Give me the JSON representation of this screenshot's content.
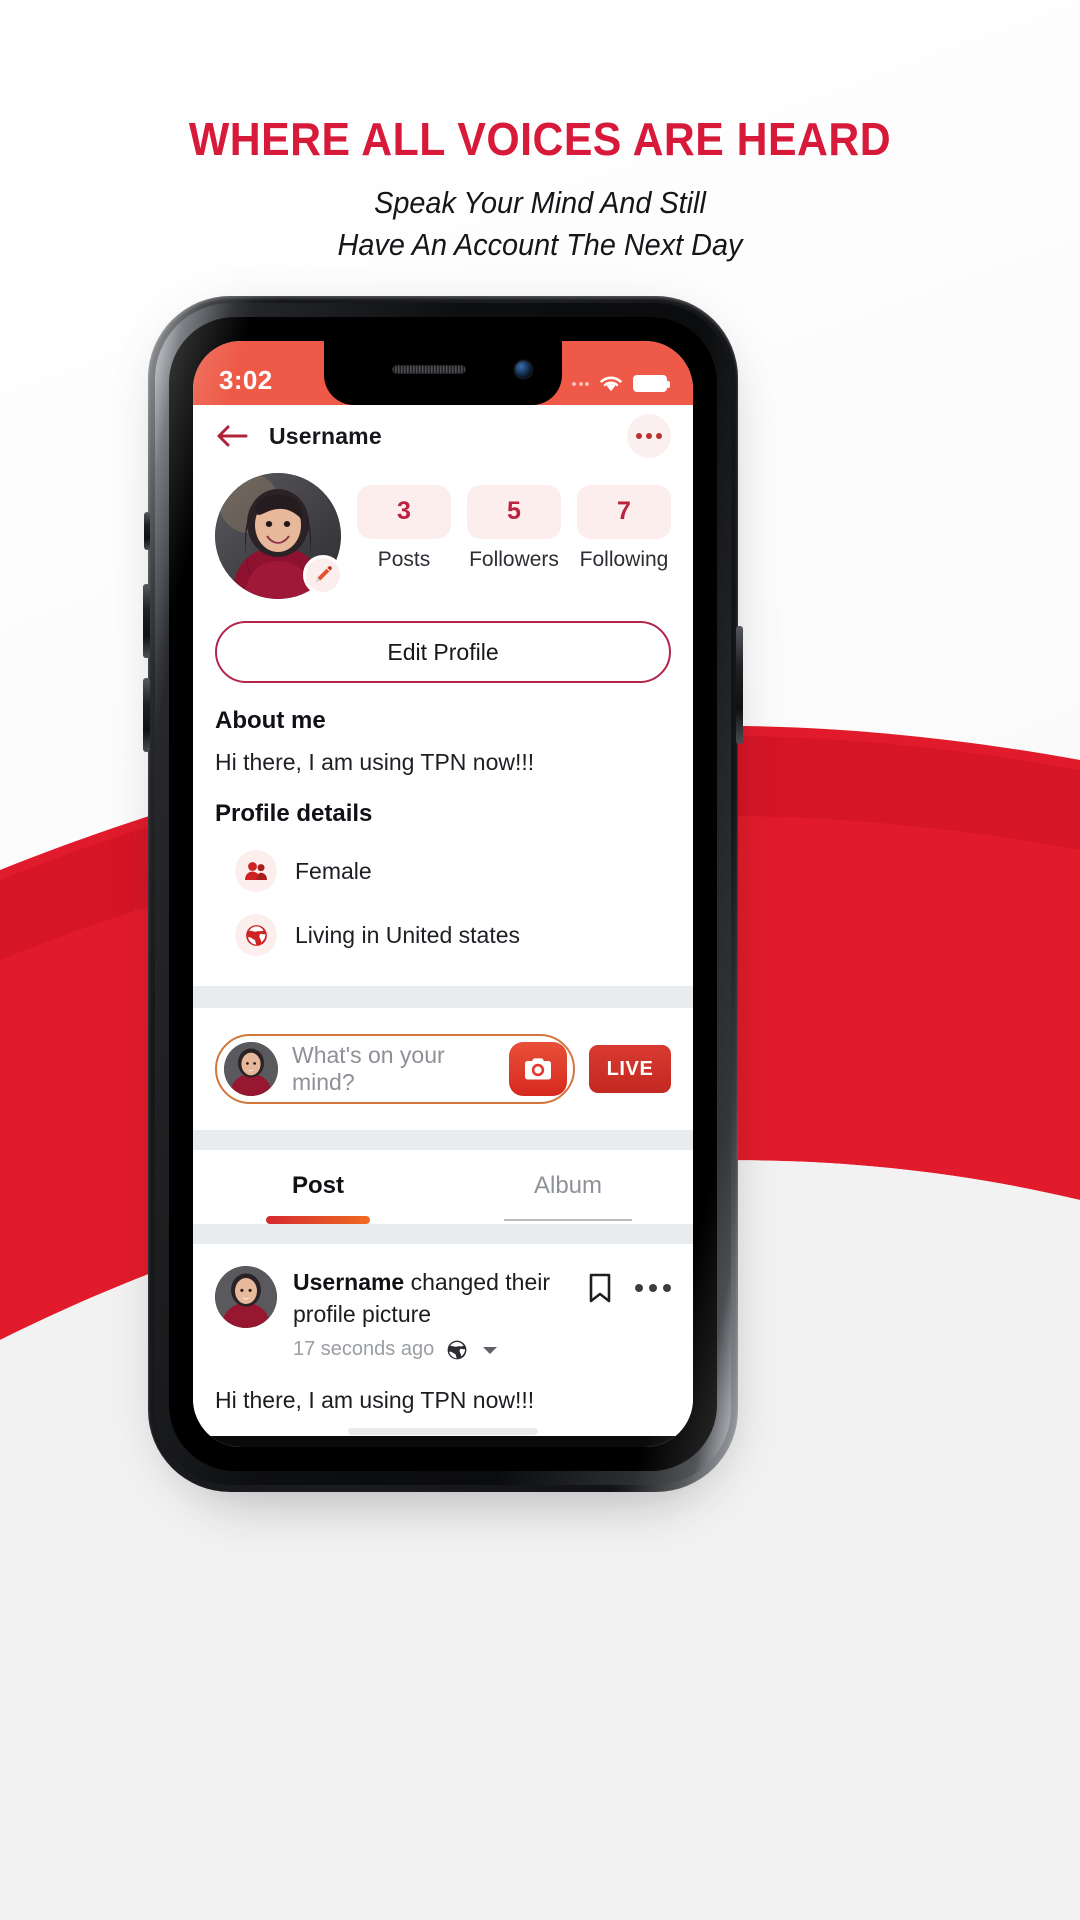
{
  "marketing": {
    "headline": "WHERE ALL VOICES ARE HEARD",
    "subhead_line1": "Speak Your Mind And Still",
    "subhead_line2": "Have An Account The Next Day",
    "headline_color": "#d81a3a",
    "swoosh_color": "#e21b2c"
  },
  "status_bar": {
    "time": "3:02",
    "wifi_icon": "wifi-icon",
    "battery_icon": "battery-full-icon",
    "background_color": "#ee5a47"
  },
  "appbar": {
    "back_icon": "back-arrow-icon",
    "title": "Username",
    "more_icon": "more-horizontal-icon"
  },
  "profile": {
    "avatar": "profile-avatar",
    "edit_badge_icon": "pencil-icon",
    "stats": [
      {
        "value": "3",
        "label": "Posts"
      },
      {
        "value": "5",
        "label": "Followers"
      },
      {
        "value": "7",
        "label": "Following"
      }
    ],
    "edit_profile_label": "Edit Profile",
    "about_heading": "About me",
    "about_text": "Hi there, I am using TPN now!!!",
    "details_heading": "Profile details",
    "details": [
      {
        "icon": "people-icon",
        "text": "Female"
      },
      {
        "icon": "globe-icon",
        "text": "Living in United states"
      }
    ],
    "pill_bg": "#fbeeec",
    "stat_value_color": "#bb2241",
    "edit_border_color": "#b2264a"
  },
  "composer": {
    "avatar": "composer-avatar",
    "placeholder": "What's on your mind?",
    "camera_icon": "camera-icon",
    "live_label": "LIVE",
    "border_color": "#d2763c"
  },
  "tabs": [
    {
      "label": "Post",
      "active": true
    },
    {
      "label": "Album",
      "active": false
    }
  ],
  "post": {
    "avatar": "post-avatar",
    "author": "Username",
    "action": "changed their profile picture",
    "timestamp": "17 seconds ago",
    "privacy_icon": "globe-icon",
    "privacy_chevron_icon": "chevron-down-icon",
    "bookmark_icon": "bookmark-icon",
    "more_icon": "more-horizontal-icon",
    "body": "Hi there, I am using TPN now!!!"
  }
}
